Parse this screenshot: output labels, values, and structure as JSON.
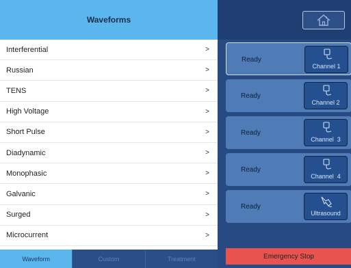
{
  "header": {
    "title": "Waveforms"
  },
  "waveforms": [
    {
      "label": "Interferential",
      "chevron": ">"
    },
    {
      "label": "Russian",
      "chevron": ">"
    },
    {
      "label": "TENS",
      "chevron": ">"
    },
    {
      "label": "High Voltage",
      "chevron": ">"
    },
    {
      "label": "Short Pulse",
      "chevron": ">"
    },
    {
      "label": "Diadynamic",
      "chevron": ">"
    },
    {
      "label": "Monophasic",
      "chevron": ">"
    },
    {
      "label": "Galvanic",
      "chevron": ">"
    },
    {
      "label": "Surged",
      "chevron": ">"
    },
    {
      "label": "Microcurrent",
      "chevron": ">"
    }
  ],
  "tabs": [
    {
      "label": "Waveform",
      "active": true
    },
    {
      "label": "Custom",
      "active": false
    },
    {
      "label": "Treatment",
      "active": false
    }
  ],
  "topbar": {
    "home_icon": "home-icon"
  },
  "channels": [
    {
      "status": "Ready",
      "label": "Channel 1",
      "icon": "electrode-icon",
      "selected": true
    },
    {
      "status": "Ready",
      "label": "Channel 2",
      "icon": "electrode-icon",
      "selected": false
    },
    {
      "status": "Ready",
      "label": "Channel  3",
      "icon": "electrode-icon",
      "selected": false
    },
    {
      "status": "Ready",
      "label": "Channel  4",
      "icon": "electrode-icon",
      "selected": false
    },
    {
      "status": "Ready",
      "label": "Ultrasound",
      "icon": "ultrasound-probe-icon",
      "selected": false
    }
  ],
  "emergency": {
    "label": "Emergency Stop"
  },
  "colors": {
    "header_bg": "#5ab6ec",
    "panel_bg": "#274a82",
    "channel_card": "#4f7bb6",
    "channel_button": "#24508f",
    "emergency": "#e9534f"
  }
}
